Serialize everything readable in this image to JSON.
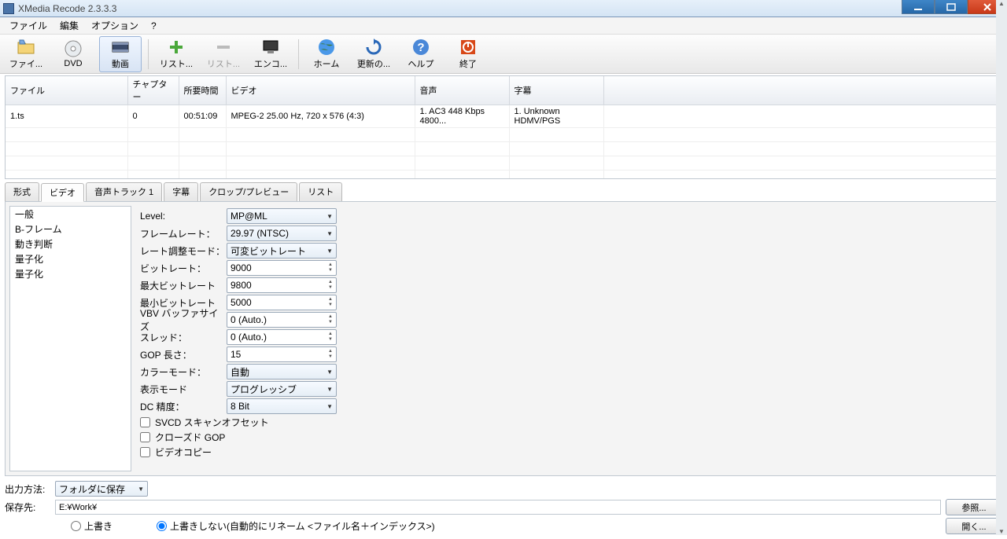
{
  "title": "XMedia Recode 2.3.3.3",
  "menu": {
    "file": "ファイル",
    "edit": "編集",
    "options": "オプション",
    "help": "?"
  },
  "toolbar": {
    "file": "ファイ...",
    "dvd": "DVD",
    "video": "動画",
    "listadd": "リスト...",
    "listremove": "リスト...",
    "encode": "エンコ...",
    "home": "ホーム",
    "update": "更新の...",
    "help_btn": "ヘルプ",
    "exit": "終了"
  },
  "table": {
    "headers": {
      "file": "ファイル",
      "chapter": "チャプター",
      "duration": "所要時間",
      "video": "ビデオ",
      "audio": "音声",
      "subtitle": "字幕"
    },
    "row": {
      "file": "1.ts",
      "chapter": "0",
      "duration": "00:51:09",
      "video": "MPEG-2 25.00 Hz, 720 x 576 (4:3)",
      "audio": "1. AC3 448 Kbps 4800...",
      "subtitle": "1. Unknown HDMV/PGS"
    }
  },
  "tabs": {
    "format": "形式",
    "video": "ビデオ",
    "audio1": "音声トラック 1",
    "subtitle": "字幕",
    "crop": "クロップ/プレビュー",
    "list": "リスト"
  },
  "side": {
    "general": "一般",
    "bframe": "B-フレーム",
    "motion": "動き判断",
    "quant1": "量子化",
    "quant2": "量子化"
  },
  "form": {
    "level_lbl": "Level:",
    "level_val": "MP@ML",
    "framerate_lbl": "フレームレート：",
    "framerate_val": "29.97 (NTSC)",
    "ratemode_lbl": "レート調整モード：",
    "ratemode_val": "可変ビットレート",
    "bitrate_lbl": "ビットレート：",
    "bitrate_val": "9000",
    "maxbit_lbl": "最大ビットレート",
    "maxbit_val": "9800",
    "minbit_lbl": "最小ビットレート",
    "minbit_val": "5000",
    "vbv_lbl": "VBV バッファサイズ",
    "vbv_val": "0 (Auto.)",
    "thread_lbl": "スレッド：",
    "thread_val": "0 (Auto.)",
    "gop_lbl": "GOP 長さ：",
    "gop_val": "15",
    "color_lbl": "カラーモード：",
    "color_val": "自動",
    "disp_lbl": "表示モード",
    "disp_val": "プログレッシブ",
    "dc_lbl": "DC 精度：",
    "dc_val": "8 Bit",
    "svcd": "SVCD スキャンオフセット",
    "closedgop": "クローズド GOP",
    "vcopy": "ビデオコピー"
  },
  "bottom": {
    "outmethod_lbl": "出力方法:",
    "outmethod_val": "フォルダに保存",
    "saveto_lbl": "保存先:",
    "saveto_val": "E:¥Work¥",
    "browse": "参照...",
    "open": "開く...",
    "overwrite": "上書き",
    "nooverwrite": "上書きしない(自動的にリネーム <ファイル名＋インデックス>)"
  }
}
